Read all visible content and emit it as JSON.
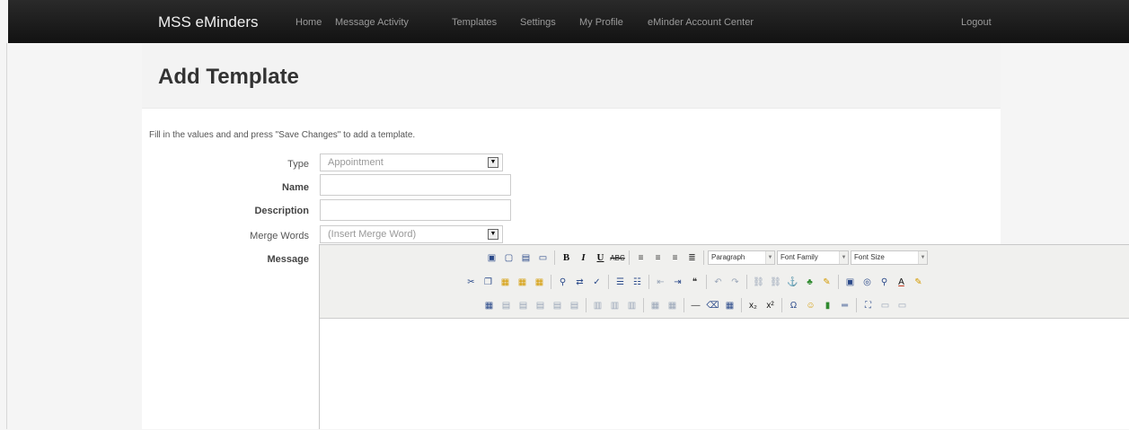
{
  "nav": {
    "brand": "MSS eMinders",
    "items": [
      "Home",
      "Message Activity",
      "Templates",
      "Settings",
      "My Profile",
      "eMinder Account Center"
    ],
    "logout": "Logout"
  },
  "page": {
    "title": "Add Template",
    "instructions": "Fill in the values and and press \"Save Changes\" to add a template."
  },
  "form": {
    "type_label": "Type",
    "type_value": "Appointment",
    "name_label": "Name",
    "name_value": "",
    "description_label": "Description",
    "description_value": "",
    "merge_label": "Merge Words",
    "merge_value": "(Insert Merge Word)",
    "message_label": "Message"
  },
  "editor": {
    "format_value": "Paragraph",
    "font_family_value": "Font Family",
    "font_size_value": "Font Size"
  }
}
